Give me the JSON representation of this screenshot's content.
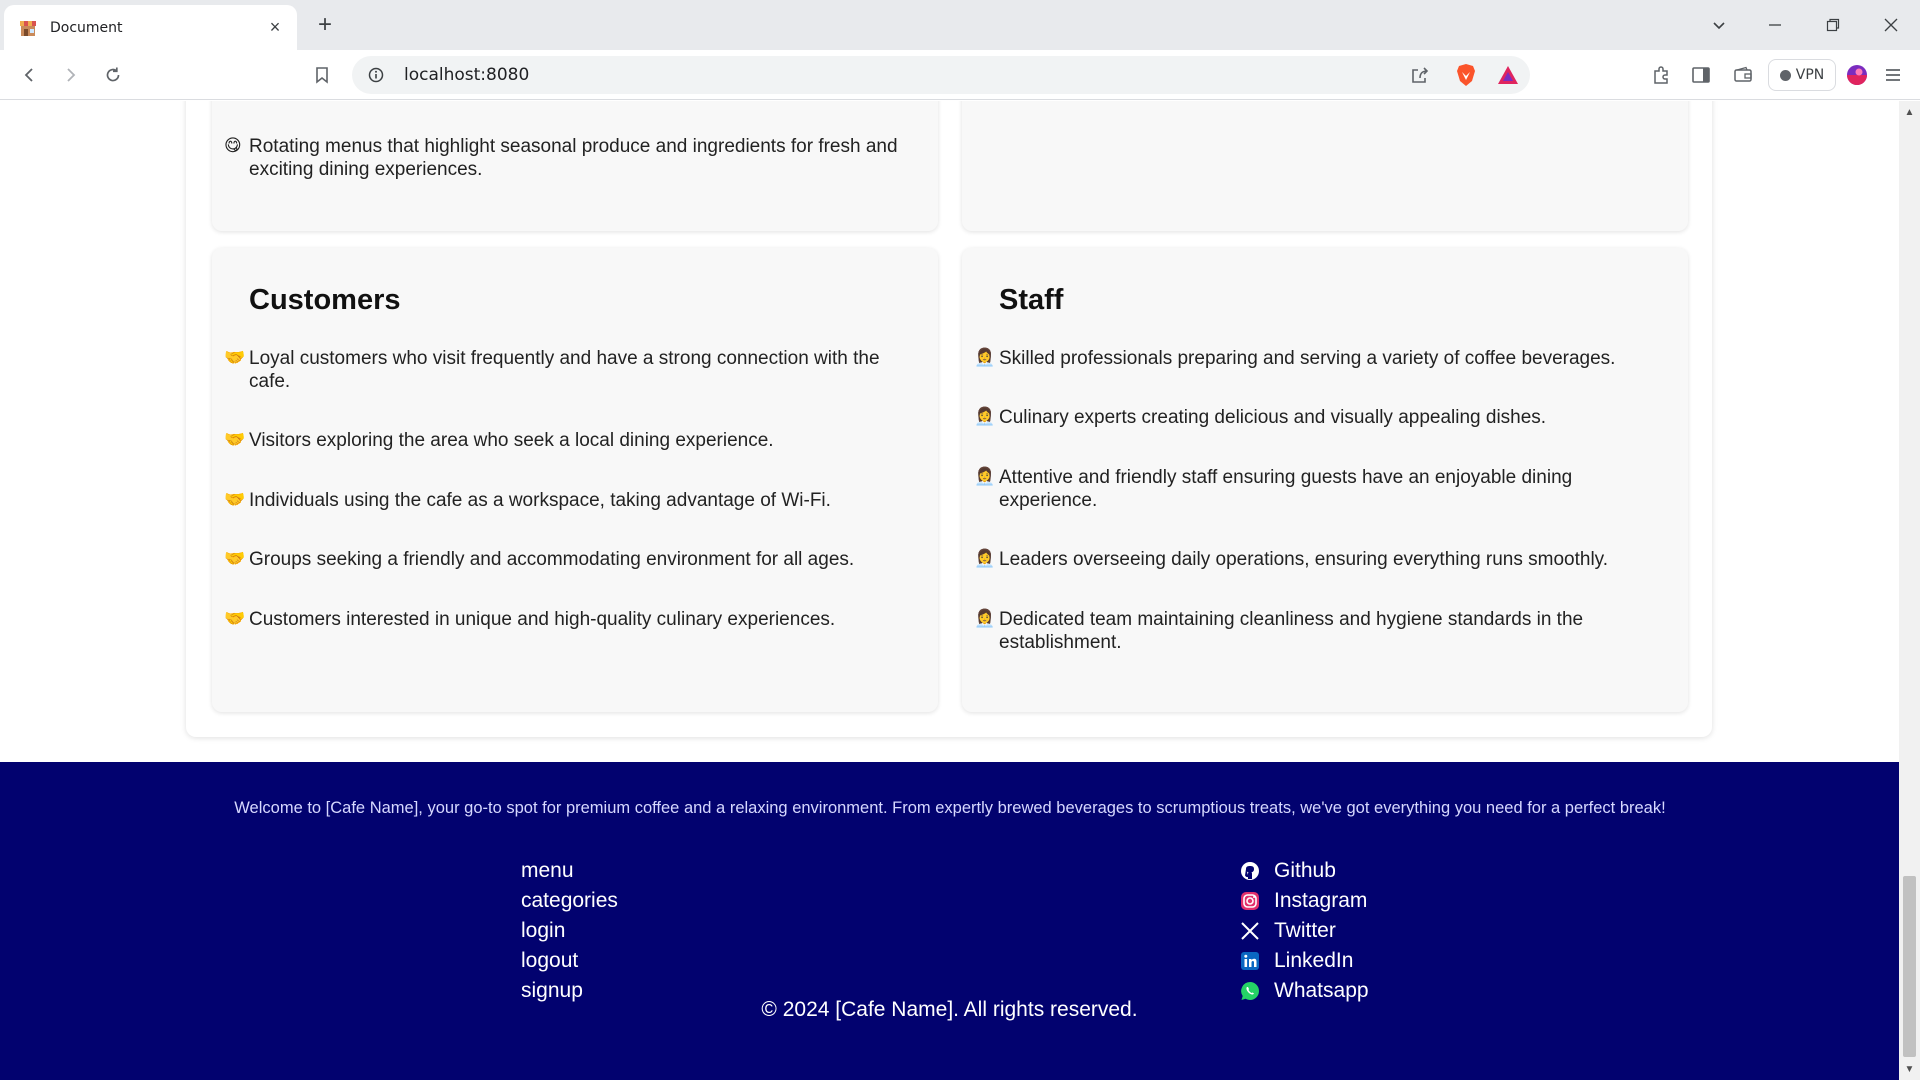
{
  "browser": {
    "tab_title": "Document",
    "url": "localhost:8080",
    "vpn_label": "VPN"
  },
  "cards": {
    "menu": {
      "item": "Rotating menus that highlight seasonal produce and ingredients for fresh and exciting dining experiences.",
      "emoji": "😋"
    },
    "customers": {
      "title": "Customers",
      "emoji": "🤝",
      "items": [
        "Loyal customers who visit frequently and have a strong connection with the cafe.",
        "Visitors exploring the area who seek a local dining experience.",
        "Individuals using the cafe as a workspace, taking advantage of Wi-Fi.",
        "Groups seeking a friendly and accommodating environment for all ages.",
        "Customers interested in unique and high-quality culinary experiences."
      ]
    },
    "staff": {
      "title": "Staff",
      "emoji": "👩‍💼",
      "items": [
        "Skilled professionals preparing and serving a variety of coffee beverages.",
        "Culinary experts creating delicious and visually appealing dishes.",
        "Attentive and friendly staff ensuring guests have an enjoyable dining experience.",
        "Leaders overseeing daily operations, ensuring everything runs smoothly.",
        "Dedicated team maintaining cleanliness and hygiene standards in the establishment."
      ]
    }
  },
  "footer": {
    "about": "Welcome to [Cafe Name], your go-to spot for premium coffee and a relaxing environment. From expertly brewed beverages to scrumptious treats, we've got everything you need for a perfect break!",
    "links": [
      "menu",
      "categories",
      "login",
      "logout",
      "signup"
    ],
    "social": [
      {
        "label": "Github",
        "icon": "github-icon"
      },
      {
        "label": "Instagram",
        "icon": "instagram-icon"
      },
      {
        "label": "Twitter",
        "icon": "x-twitter-icon"
      },
      {
        "label": "LinkedIn",
        "icon": "linkedin-icon"
      },
      {
        "label": "Whatsapp",
        "icon": "whatsapp-icon"
      }
    ],
    "copyright": "© 2024 [Cafe Name]. All rights reserved."
  },
  "colors": {
    "footer_bg": "#02026f",
    "card_bg": "#f8f8f8",
    "brave_orange": "#fb542b"
  }
}
